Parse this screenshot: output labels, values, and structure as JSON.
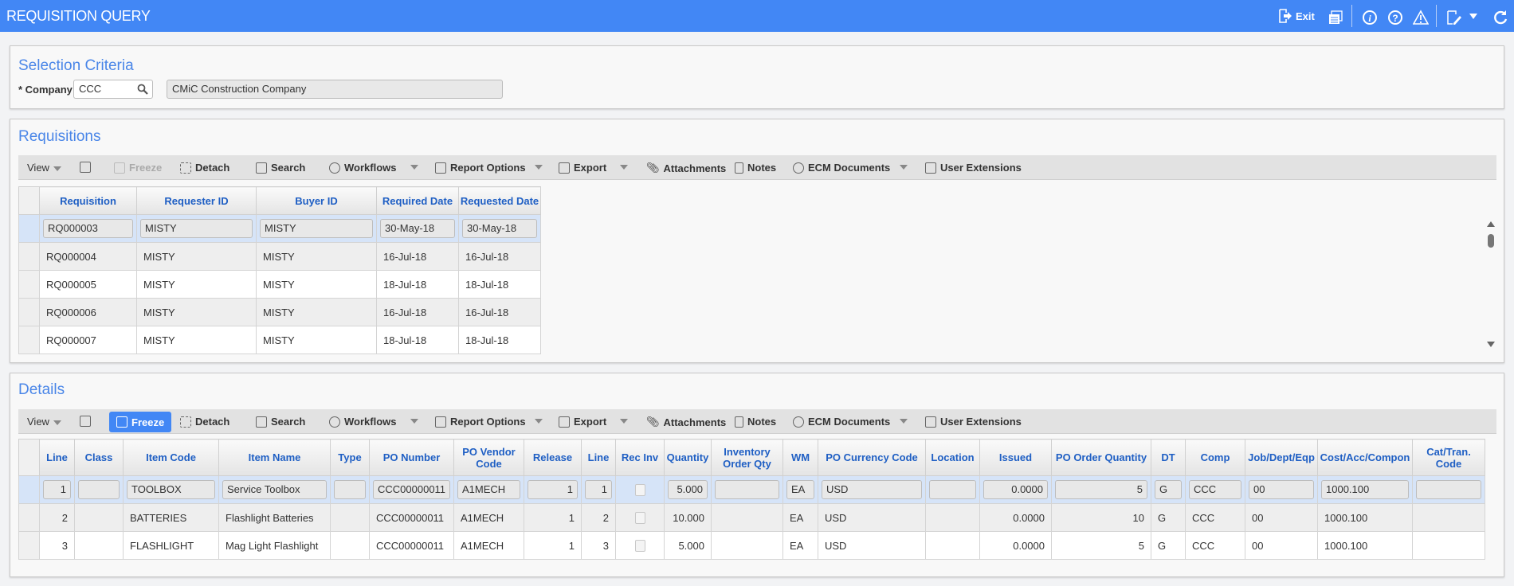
{
  "app": {
    "title": "REQUISITION QUERY",
    "exit_label": "Exit",
    "accent": "#4287f5",
    "icons": [
      "exit-icon",
      "print-icon",
      "info-icon",
      "help-icon",
      "warning-icon",
      "edit-icon",
      "dropdown-icon",
      "refresh-icon"
    ]
  },
  "selection": {
    "title": "Selection Criteria",
    "company_label": "* Company",
    "company_value": "CCC",
    "company_name": "CMiC Construction Company"
  },
  "toolbar": {
    "view": "View",
    "freeze": "Freeze",
    "detach": "Detach",
    "search": "Search",
    "workflows": "Workflows",
    "report_options": "Report Options",
    "export": "Export",
    "attachments": "Attachments",
    "notes": "Notes",
    "ecm_documents": "ECM Documents",
    "user_extensions": "User Extensions"
  },
  "requisitions": {
    "title": "Requisitions",
    "columns": [
      "Requisition",
      "Requester ID",
      "Buyer ID",
      "Required Date",
      "Requested Date"
    ],
    "rows": [
      [
        "RQ000003",
        "MISTY",
        "MISTY",
        "30-May-18",
        "30-May-18"
      ],
      [
        "RQ000004",
        "MISTY",
        "MISTY",
        "16-Jul-18",
        "16-Jul-18"
      ],
      [
        "RQ000005",
        "MISTY",
        "MISTY",
        "18-Jul-18",
        "18-Jul-18"
      ],
      [
        "RQ000006",
        "MISTY",
        "MISTY",
        "16-Jul-18",
        "16-Jul-18"
      ],
      [
        "RQ000007",
        "MISTY",
        "MISTY",
        "18-Jul-18",
        "18-Jul-18"
      ]
    ]
  },
  "details": {
    "title": "Details",
    "columns": [
      "Line",
      "Class",
      "Item Code",
      "Item Name",
      "Type",
      "PO Number",
      "PO Vendor Code",
      "Release",
      "Line",
      "Rec Inv",
      "Quantity",
      "Inventory Order Qty",
      "WM",
      "PO Currency Code",
      "Location",
      "Issued",
      "PO Order Quantity",
      "DT",
      "Comp",
      "Job/Dept/Eqp",
      "Cost/Acc/Compon",
      "Cat/Tran. Code"
    ],
    "rows": [
      [
        "1",
        "",
        "TOOLBOX",
        "Service Toolbox",
        "",
        "CCC00000011",
        "A1MECH",
        "1",
        "1",
        "",
        "5.000",
        "",
        "EA",
        "USD",
        "",
        "0.0000",
        "5",
        "G",
        "CCC",
        "00",
        "1000.100",
        ""
      ],
      [
        "2",
        "",
        "BATTERIES",
        "Flashlight Batteries",
        "",
        "CCC00000011",
        "A1MECH",
        "1",
        "2",
        "",
        "10.000",
        "",
        "EA",
        "USD",
        "",
        "0.0000",
        "10",
        "G",
        "CCC",
        "00",
        "1000.100",
        ""
      ],
      [
        "3",
        "",
        "FLASHLIGHT",
        "Mag Light Flashlight",
        "",
        "CCC00000011",
        "A1MECH",
        "1",
        "3",
        "",
        "5.000",
        "",
        "EA",
        "USD",
        "",
        "0.0000",
        "5",
        "G",
        "CCC",
        "00",
        "1000.100",
        ""
      ]
    ]
  }
}
